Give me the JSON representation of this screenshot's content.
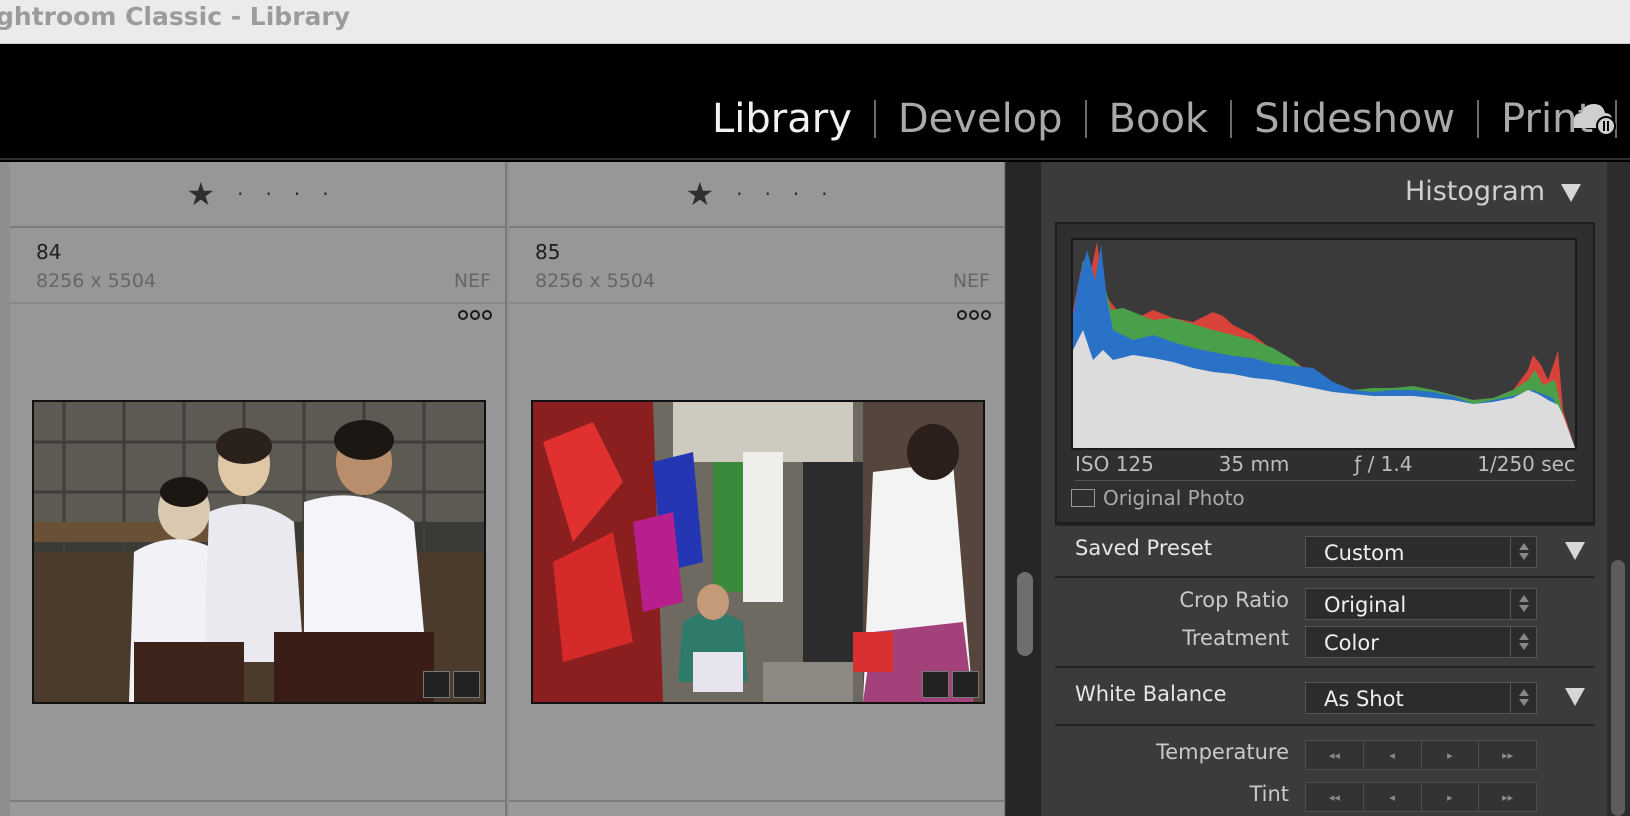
{
  "window": {
    "title": "ghtroom Classic - Library"
  },
  "modules": [
    {
      "label": "Library",
      "active": true
    },
    {
      "label": "Develop",
      "active": false
    },
    {
      "label": "Book",
      "active": false
    },
    {
      "label": "Slideshow",
      "active": false
    },
    {
      "label": "Print",
      "active": false
    }
  ],
  "cloud_icon": "cloud-sync-paused-icon",
  "grid": {
    "cells": [
      {
        "rating": 1,
        "number": "84",
        "dimensions": "8256 x 5504",
        "format": "NEF"
      },
      {
        "rating": 1,
        "number": "85",
        "dimensions": "8256 x 5504",
        "format": "NEF"
      }
    ]
  },
  "histogram": {
    "title": "Histogram",
    "iso": "ISO 125",
    "focal_length": "35 mm",
    "aperture": "ƒ / 1.4",
    "shutter": "1/250 sec",
    "original_photo_label": "Original Photo",
    "original_photo_checked": false,
    "colors": {
      "red": "#d9423a",
      "green": "#4aa04a",
      "blue": "#2a72c8",
      "luminance": "#dcdcdc"
    }
  },
  "quick_develop": {
    "saved_preset": {
      "label": "Saved Preset",
      "value": "Custom"
    },
    "crop_ratio": {
      "label": "Crop Ratio",
      "value": "Original"
    },
    "treatment": {
      "label": "Treatment",
      "value": "Color"
    },
    "white_balance": {
      "label": "White Balance",
      "value": "As Shot"
    },
    "temperature": {
      "label": "Temperature"
    },
    "tint": {
      "label": "Tint"
    },
    "stepper_glyphs": [
      "◂◂",
      "◂",
      "▸",
      "▸▸"
    ]
  }
}
